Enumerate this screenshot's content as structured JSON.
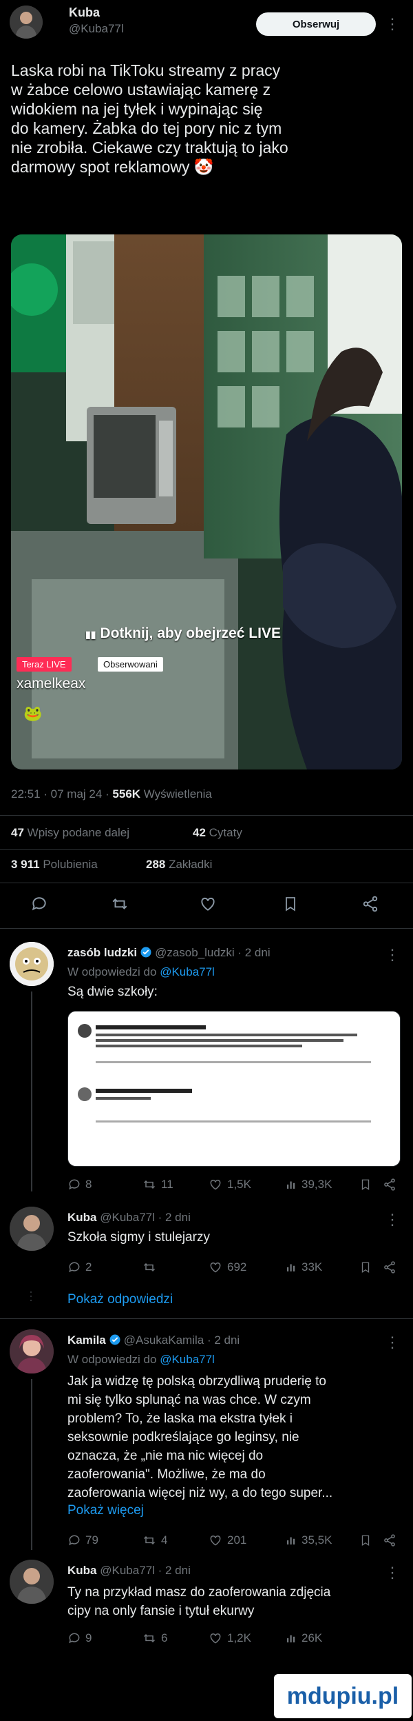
{
  "main_post": {
    "author_name": "Kuba",
    "author_handle": "@Kuba77l",
    "follow_button": "Obserwuj",
    "text_lines": [
      "Laska robi na TikToku streamy z pracy",
      "w żabce celowo ustawiając kamerę z",
      "widokiem na jej tyłek i wypinając się",
      "do kamery. Żabka do tej pory nic z tym",
      "nie zrobiła. Ciekawe czy traktują to jako",
      "darmowy spot reklamowy"
    ],
    "emoji": "🤡",
    "image": {
      "overlay_text": "Dotknij, aby obejrzeć LIVE",
      "live_badge": "Teraz LIVE",
      "observed_badge": "Obserwowani",
      "username": "xamelkeax"
    },
    "timestamp": "22:51 · 07 maj 24 · ",
    "views_count": "556K",
    "views_label": " Wyświetlenia",
    "stats": {
      "quotes_count": "47",
      "quotes_label": " Wpisy podane dalej",
      "cited_count": "42",
      "cited_label": " Cytaty",
      "likes_count": "3 911",
      "likes_label": " Polubienia",
      "bookmarks_count": "288",
      "bookmarks_label": " Zakładki"
    }
  },
  "replies": [
    {
      "name": "zasób ludzki",
      "handle": "@zasob_ludzki",
      "time": " · 2 dni",
      "reply_to_prefix": "W odpowiedzi do ",
      "reply_to": "@Kuba77l",
      "text": "Są dwie szkoły:",
      "counts": {
        "reply": "8",
        "retweet": "11",
        "like": "1,5K",
        "views": "39,3K"
      }
    },
    {
      "name": "Kuba",
      "handle": "@Kuba77l",
      "time": " · 2 dni",
      "text": "Szkoła sigmy i stulejarzy",
      "counts": {
        "reply": "2",
        "retweet": "",
        "like": "692",
        "views": "33K"
      },
      "show_replies": "Pokaż odpowiedzi"
    },
    {
      "name": "Kamila",
      "handle": "@AsukaKamila",
      "time": " · 2 dni",
      "reply_to_prefix": "W odpowiedzi do ",
      "reply_to": "@Kuba77l",
      "text_lines": [
        "Jak ja widzę tę polską obrzydliwą pruderię to",
        "mi się tylko splunąć na was chce. W czym",
        "problem? To, że laska ma ekstra tyłek i",
        "seksownie podkreślające go leginsy, nie",
        "oznacza, że „nie ma nic więcej do",
        "zaoferowania\". Możliwe, że ma do",
        "zaoferowania więcej niż wy, a do tego super..."
      ],
      "show_more": "Pokaż więcej",
      "counts": {
        "reply": "79",
        "retweet": "4",
        "like": "201",
        "views": "35,5K"
      }
    },
    {
      "name": "Kuba",
      "handle": "@Kuba77l",
      "time": " · 2 dni",
      "text_lines": [
        "Ty na przykład masz do zaoferowania zdjęcia",
        "cipy na only fansie i tytuł ekurwy"
      ],
      "counts": {
        "reply": "9",
        "retweet": "6",
        "like": "1,2K",
        "views": "26K"
      }
    }
  ],
  "watermark": "mdupiu.pl",
  "colors": {
    "accent": "#1d9bf0",
    "muted": "#71767b",
    "live_red": "#fe2c55"
  }
}
